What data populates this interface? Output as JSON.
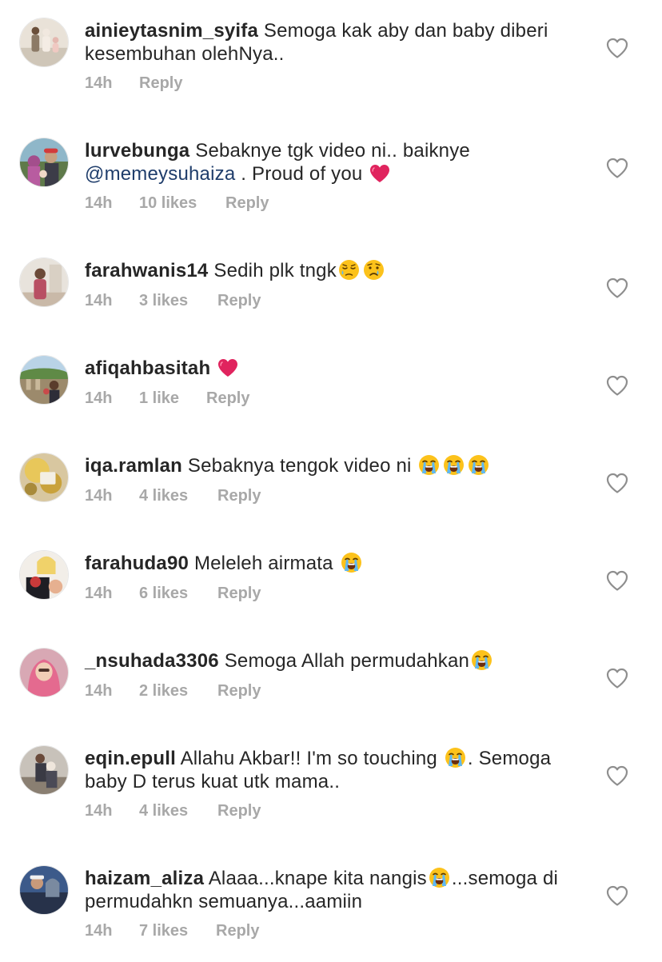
{
  "comments": [
    {
      "username": "ainieytasnim_syifa",
      "text": "Semoga kak aby dan baby diberi kesembuhan olehNya..",
      "time": "14h",
      "likes": "",
      "reply": "Reply"
    },
    {
      "username": "lurvebunga",
      "text_before": "Sebaknye tgk video ni.. baiknye",
      "mention": "@memeysuhaiza",
      "text_after": ". Proud of you",
      "emoji": [
        "red-heart"
      ],
      "time": "14h",
      "likes": "10 likes",
      "reply": "Reply"
    },
    {
      "username": "farahwanis14",
      "text": "Sedih plk tngk",
      "emoji": [
        "sad-but-relieved-face",
        "crying-face"
      ],
      "time": "14h",
      "likes": "3 likes",
      "reply": "Reply"
    },
    {
      "username": "afiqahbasitah",
      "text": "",
      "emoji": [
        "red-heart"
      ],
      "time": "14h",
      "likes": "1 like",
      "reply": "Reply"
    },
    {
      "username": "iqa.ramlan",
      "text": "Sebaknya tengok video ni",
      "emoji": [
        "loudly-crying-face",
        "loudly-crying-face",
        "loudly-crying-face"
      ],
      "time": "14h",
      "likes": "4 likes",
      "reply": "Reply"
    },
    {
      "username": "farahuda90",
      "text": "Meleleh airmata",
      "emoji": [
        "loudly-crying-face"
      ],
      "time": "14h",
      "likes": "6 likes",
      "reply": "Reply"
    },
    {
      "username": "_nsuhada3306",
      "text": "Semoga Allah permudahkan",
      "emoji": [
        "loudly-crying-face"
      ],
      "time": "14h",
      "likes": "2 likes",
      "reply": "Reply"
    },
    {
      "username": "eqin.epull",
      "text_before": "Allahu Akbar!! I'm so touching",
      "text_after": ". Semoga baby D terus kuat utk mama..",
      "emoji": [
        "loudly-crying-face"
      ],
      "time": "14h",
      "likes": "4 likes",
      "reply": "Reply"
    },
    {
      "username": "haizam_aliza",
      "text_before": "Alaaa...knape kita nangis",
      "text_after": "...semoga di permudahkn semuanya...aamiin",
      "emoji": [
        "loudly-crying-face"
      ],
      "time": "14h",
      "likes": "7 likes",
      "reply": "Reply"
    }
  ],
  "icons": {
    "like_button": "heart-outline-icon"
  },
  "colors": {
    "username": "#262626",
    "text": "#262626",
    "meta": "#a8a8a8",
    "mention": "#1f3d6b",
    "heart_icon": "#8e8e8e",
    "red_heart": "#e0245e"
  }
}
